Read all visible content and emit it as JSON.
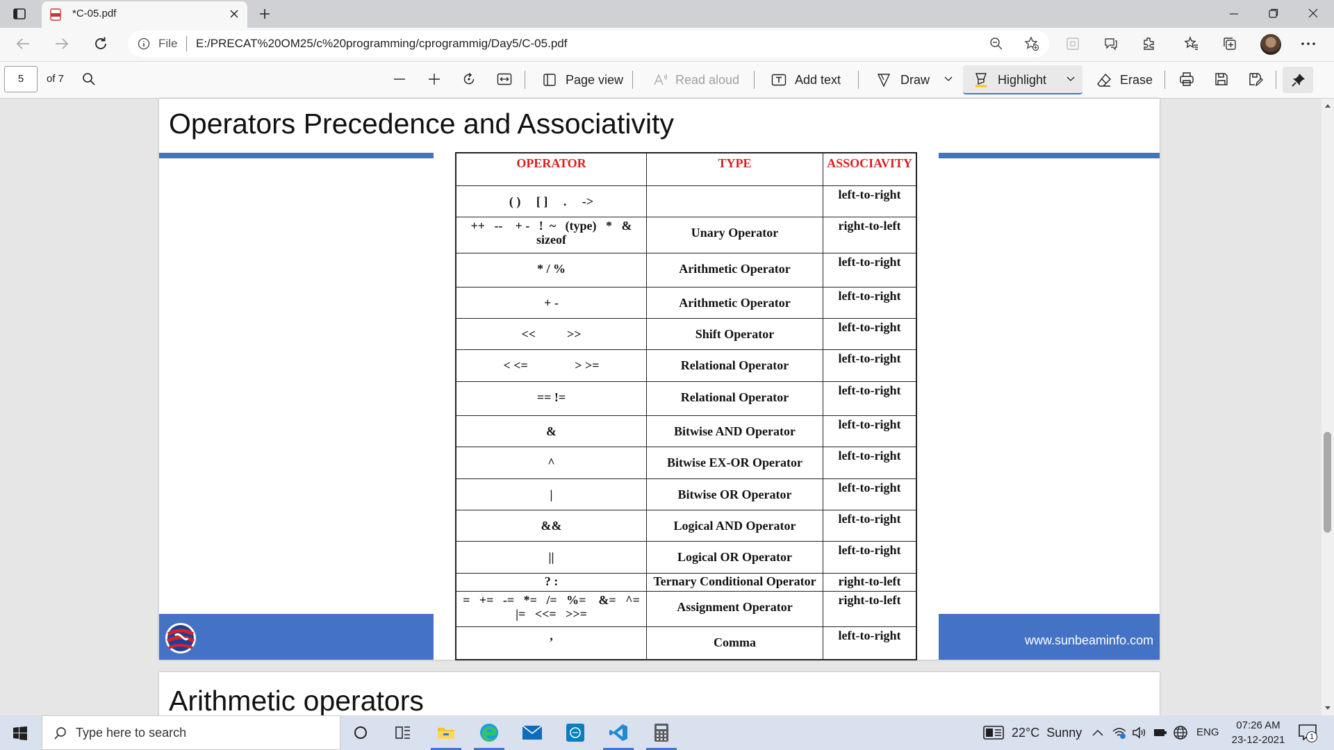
{
  "browser": {
    "tab_title": "*C-05.pdf",
    "url_prefix": "File",
    "url": "E:/PRECAT%20OM25/c%20programming/cprogrammig/Day5/C-05.pdf"
  },
  "pdf_toolbar": {
    "page_number": "5",
    "page_total": "of 7",
    "page_view": "Page view",
    "read_aloud": "Read aloud",
    "add_text": "Add text",
    "draw": "Draw",
    "highlight": "Highlight",
    "erase": "Erase"
  },
  "page1": {
    "title": "Operators Precedence and Associativity",
    "footer_url": "www.sunbeaminfo.com",
    "table": {
      "headers": [
        "OPERATOR",
        "TYPE",
        "ASSOCIAVITY"
      ],
      "rows": [
        {
          "op": "( )     [ ]     .     ->",
          "type": "",
          "assoc": "left-to-right"
        },
        {
          "op": "++   --    + -   !  ~   (type)   *   &   sizeof",
          "type": "Unary Operator",
          "assoc": "right-to-left"
        },
        {
          "op": "* / %",
          "type": "Arithmetic Operator",
          "assoc": "left-to-right"
        },
        {
          "op": "+ -",
          "type": "Arithmetic Operator",
          "assoc": "left-to-right"
        },
        {
          "op": "<<          >>",
          "type": "Shift Operator",
          "assoc": "left-to-right"
        },
        {
          "op": "< <=               > >=",
          "type": "Relational Operator",
          "assoc": "left-to-right"
        },
        {
          "op": "== !=",
          "type": "Relational Operator",
          "assoc": "left-to-right"
        },
        {
          "op": "&",
          "type": "Bitwise AND Operator",
          "assoc": "left-to-right"
        },
        {
          "op": "^",
          "type": "Bitwise EX-OR Operator",
          "assoc": "left-to-right"
        },
        {
          "op": "|",
          "type": "Bitwise OR Operator",
          "assoc": "left-to-right"
        },
        {
          "op": "&&",
          "type": "Logical AND Operator",
          "assoc": "left-to-right"
        },
        {
          "op": "||",
          "type": "Logical OR Operator",
          "assoc": "left-to-right"
        },
        {
          "op": "? :",
          "type": "Ternary Conditional Operator",
          "assoc": "right-to-left"
        },
        {
          "op": "=   +=   -=   *=   /=   %=    &=   ^=   |=   <<=   >>=",
          "type": "Assignment Operator",
          "assoc": "right-to-left"
        },
        {
          "op": ",",
          "type": "Comma",
          "assoc": "left-to-right"
        }
      ]
    }
  },
  "page2": {
    "title": "Arithmetic operators"
  },
  "taskbar": {
    "search_placeholder": "Type here to search",
    "weather": "22°C  Sunny",
    "language": "ENG",
    "time": "07:26 AM",
    "date": "23-12-2021",
    "notification_count": "1"
  },
  "colors": {
    "accent_blue": "#4472c4",
    "header_red": "#e01b1b"
  }
}
